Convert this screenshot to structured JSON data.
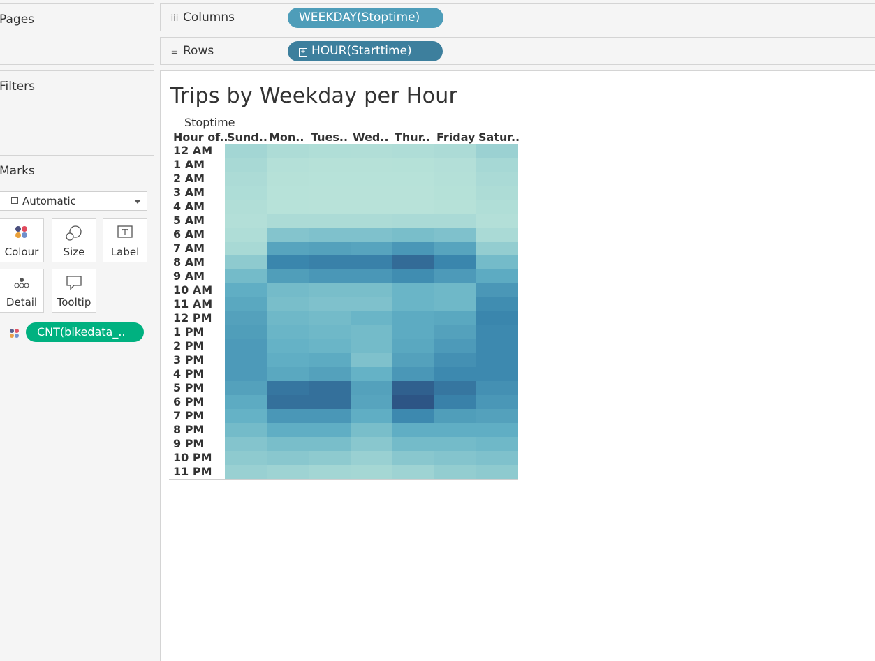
{
  "cards": {
    "pages_title": "Pages",
    "filters_title": "Filters",
    "marks_title": "Marks"
  },
  "marks": {
    "type": "Automatic",
    "buttons": [
      {
        "label": "Colour",
        "icon": "colour-dots-icon"
      },
      {
        "label": "Size",
        "icon": "size-circles-icon"
      },
      {
        "label": "Label",
        "icon": "label-text-icon"
      },
      {
        "label": "Detail",
        "icon": "detail-dots-icon"
      },
      {
        "label": "Tooltip",
        "icon": "tooltip-bubble-icon"
      }
    ],
    "colour_field": "CNT(bikedata_..",
    "colour_field_color": "#00b180"
  },
  "shelves": {
    "columns_label": "Columns",
    "columns_icon": "iii",
    "columns_pill": "WEEKDAY(Stoptime)",
    "columns_pill_color": "#4e9db9",
    "rows_label": "Rows",
    "rows_icon": "≡",
    "rows_pill": "HOUR(Starttime)",
    "rows_pill_color": "#3d7f9d"
  },
  "sheet": {
    "title": "Trips by Weekday per Hour",
    "field_label": "Stoptime",
    "row_field_header": "Hour of.."
  },
  "chart_data": {
    "type": "heatmap",
    "title": "Trips by Weekday per Hour",
    "xlabel": "Stoptime",
    "ylabel": "Hour of..",
    "x": [
      "Sund..",
      "Mon..",
      "Tues..",
      "Wed..",
      "Thur..",
      "Friday",
      "Satur.."
    ],
    "y": [
      "12 AM",
      "1 AM",
      "2 AM",
      "3 AM",
      "4 AM",
      "5 AM",
      "6 AM",
      "7 AM",
      "8 AM",
      "9 AM",
      "10 AM",
      "11 AM",
      "12 PM",
      "1 PM",
      "2 PM",
      "3 PM",
      "4 PM",
      "5 PM",
      "6 PM",
      "7 PM",
      "8 PM",
      "9 PM",
      "10 PM",
      "11 PM"
    ],
    "value_scale": "relative 0-100 (colour intensity, CNT of bikedata)",
    "values": [
      [
        30,
        18,
        15,
        14,
        16,
        20,
        33
      ],
      [
        24,
        10,
        8,
        8,
        9,
        12,
        26
      ],
      [
        20,
        8,
        7,
        7,
        7,
        10,
        22
      ],
      [
        17,
        7,
        6,
        6,
        6,
        9,
        19
      ],
      [
        14,
        7,
        6,
        6,
        6,
        8,
        15
      ],
      [
        12,
        20,
        20,
        20,
        22,
        22,
        12
      ],
      [
        16,
        42,
        44,
        44,
        46,
        44,
        22
      ],
      [
        24,
        62,
        64,
        62,
        70,
        62,
        36
      ],
      [
        38,
        80,
        82,
        82,
        90,
        80,
        48
      ],
      [
        48,
        66,
        70,
        70,
        76,
        68,
        58
      ],
      [
        56,
        48,
        46,
        46,
        52,
        50,
        70
      ],
      [
        60,
        46,
        44,
        44,
        52,
        50,
        76
      ],
      [
        64,
        50,
        48,
        52,
        58,
        60,
        80
      ],
      [
        66,
        52,
        50,
        48,
        58,
        64,
        78
      ],
      [
        68,
        54,
        52,
        48,
        60,
        68,
        78
      ],
      [
        68,
        56,
        58,
        44,
        64,
        74,
        78
      ],
      [
        68,
        60,
        64,
        54,
        70,
        78,
        78
      ],
      [
        64,
        86,
        88,
        64,
        94,
        86,
        74
      ],
      [
        58,
        88,
        88,
        62,
        98,
        82,
        70
      ],
      [
        54,
        70,
        70,
        56,
        78,
        66,
        64
      ],
      [
        48,
        56,
        56,
        46,
        56,
        56,
        56
      ],
      [
        42,
        46,
        46,
        40,
        48,
        48,
        50
      ],
      [
        38,
        40,
        38,
        34,
        40,
        42,
        44
      ],
      [
        34,
        32,
        30,
        28,
        32,
        36,
        38
      ]
    ],
    "color_low": "#bde5da",
    "color_high": "#2c4f80",
    "legend": "none",
    "grid": false
  }
}
